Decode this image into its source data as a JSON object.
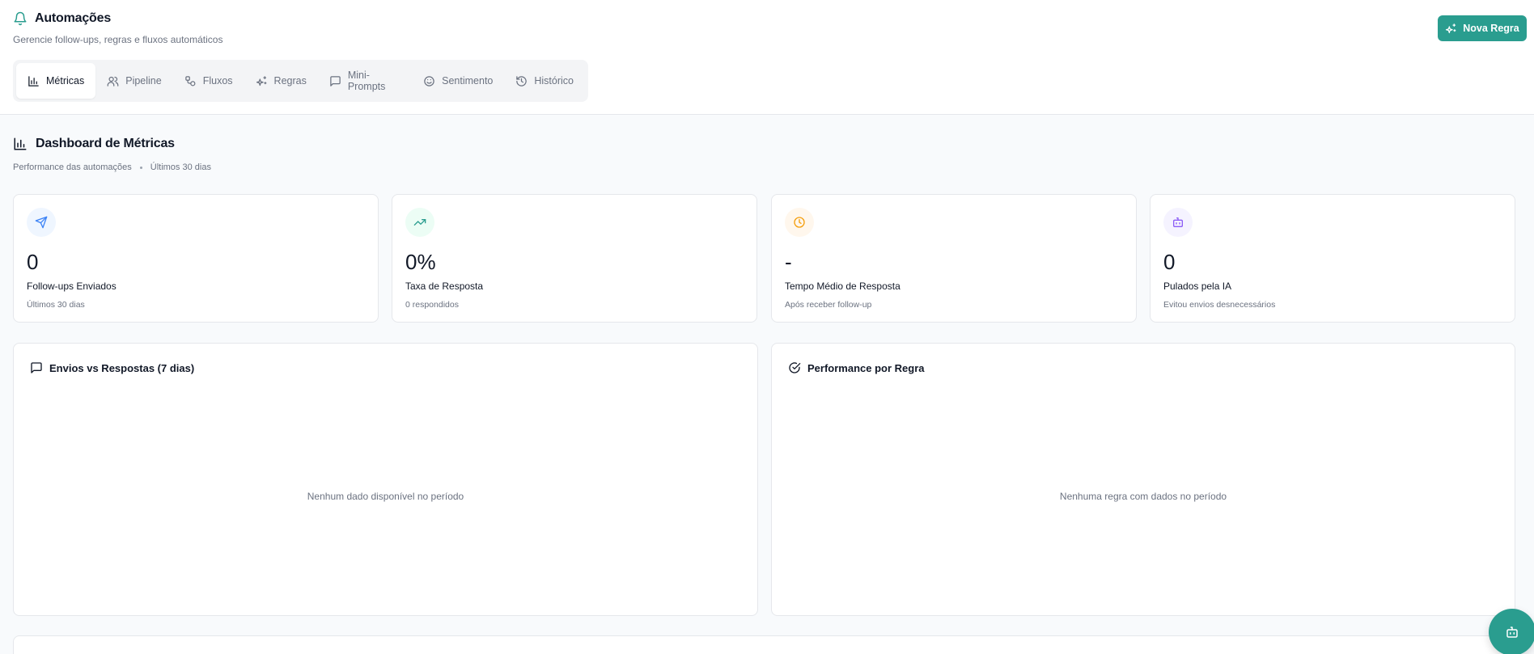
{
  "header": {
    "title": "Automações",
    "subtitle": "Gerencie follow-ups, regras e fluxos automáticos",
    "new_rule_label": "Nova Regra"
  },
  "tabs": [
    {
      "label": "Métricas",
      "icon": "bar-chart-icon",
      "active": true
    },
    {
      "label": "Pipeline",
      "icon": "users-icon",
      "active": false
    },
    {
      "label": "Fluxos",
      "icon": "workflow-icon",
      "active": false
    },
    {
      "label": "Regras",
      "icon": "sparkles-icon",
      "active": false
    },
    {
      "label": "Mini-Prompts",
      "icon": "message-square-icon",
      "active": false
    },
    {
      "label": "Sentimento",
      "icon": "smile-icon",
      "active": false
    },
    {
      "label": "Histórico",
      "icon": "history-icon",
      "active": false
    }
  ],
  "dashboard": {
    "title": "Dashboard de Métricas",
    "subtitle": "Performance das automações",
    "period": "Últimos 30 dias"
  },
  "cards": [
    {
      "icon": "send-icon",
      "value": "0",
      "label": "Follow-ups Enviados",
      "sub": "Últimos 30 dias",
      "color": "#3b82f6"
    },
    {
      "icon": "trending-up-icon",
      "value": "0%",
      "label": "Taxa de Resposta",
      "sub": "0 respondidos",
      "color": "#2a9d8f"
    },
    {
      "icon": "clock-icon",
      "value": "-",
      "label": "Tempo Médio de Resposta",
      "sub": "Após receber follow-up",
      "color": "#f59e0b"
    },
    {
      "icon": "bot-icon",
      "value": "0",
      "label": "Pulados pela IA",
      "sub": "Evitou envios desnecessários",
      "color": "#8b5cf6"
    }
  ],
  "panels": {
    "sends_vs_responses": {
      "title": "Envios vs Respostas (7 dias)",
      "empty": "Nenhum dado disponível no período"
    },
    "performance_by_rule": {
      "title": "Performance por Regra",
      "empty": "Nenhuma regra com dados no período"
    }
  },
  "colors": {
    "accent": "#2a9d8f"
  }
}
